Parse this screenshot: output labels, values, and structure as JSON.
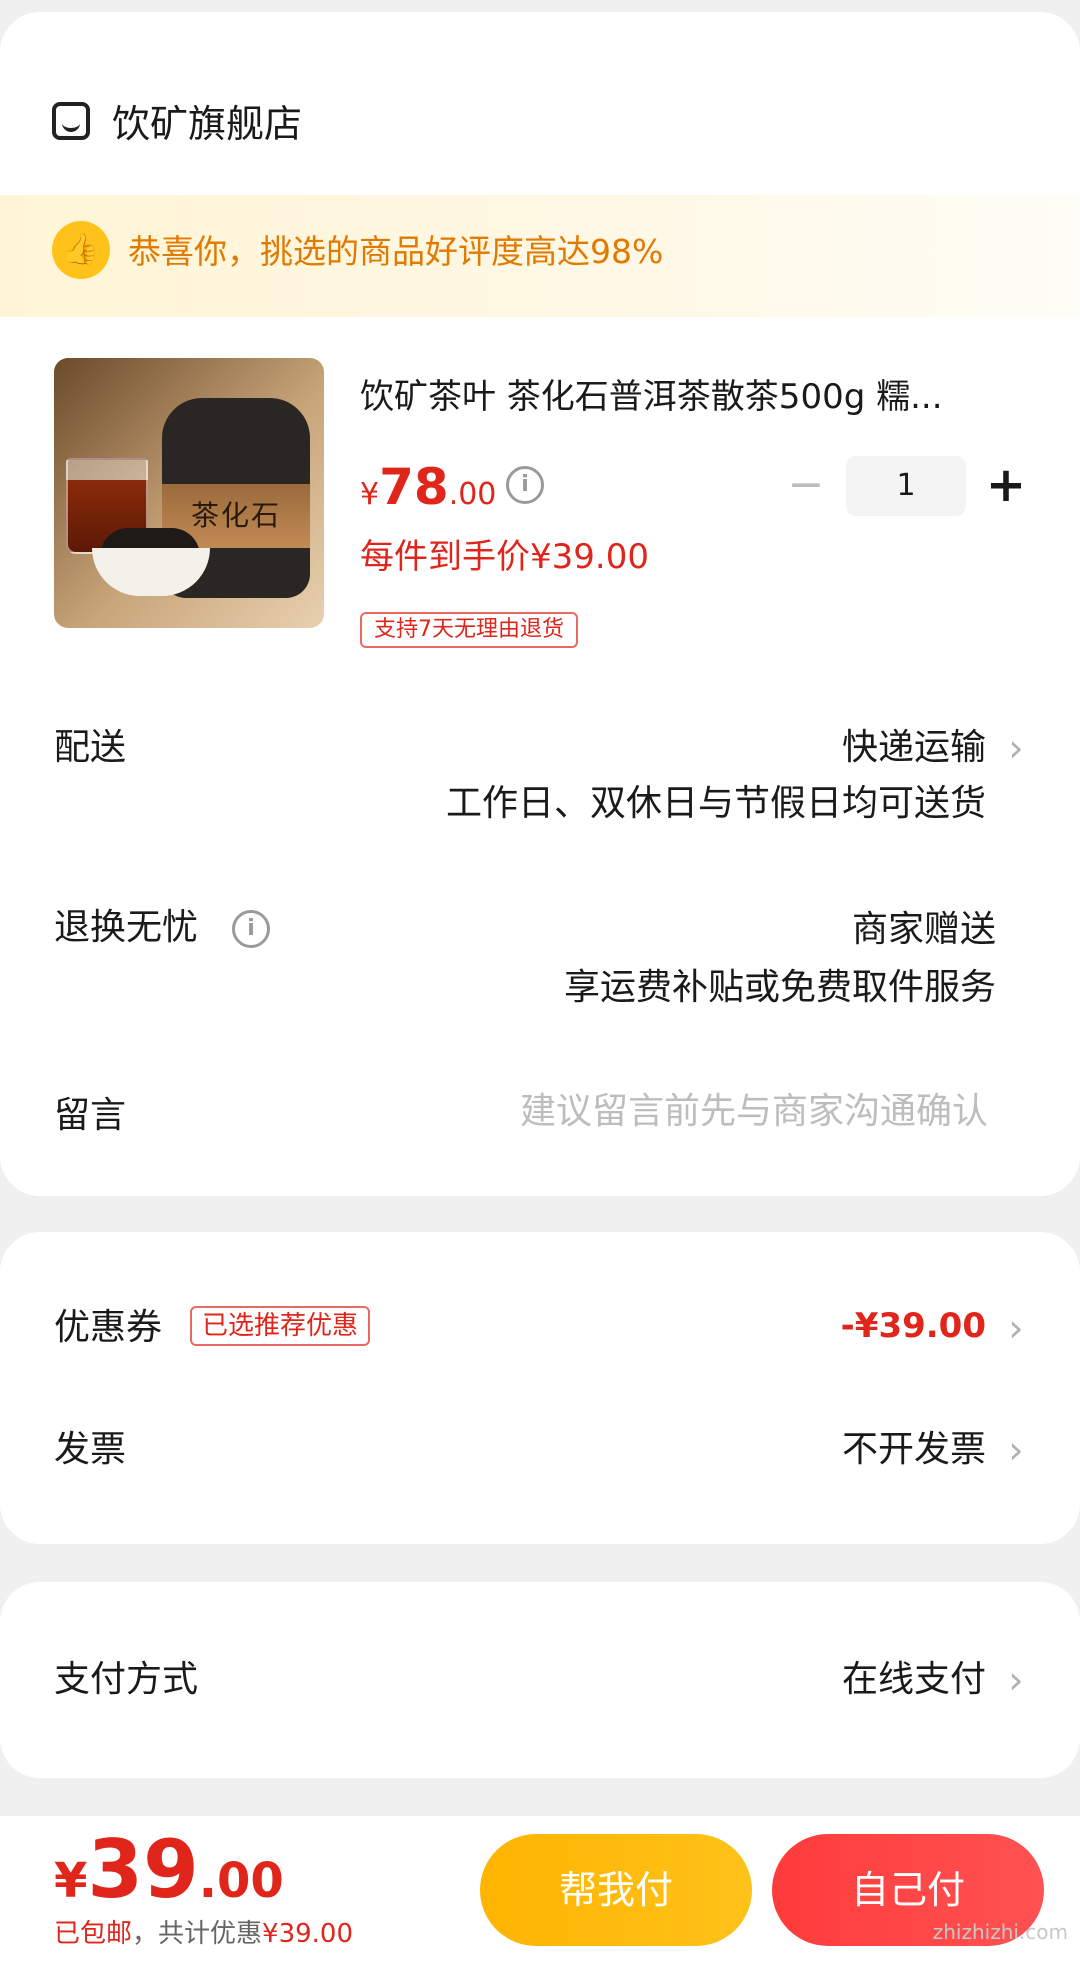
{
  "store": {
    "name": "饮矿旗舰店",
    "icon": "store-icon"
  },
  "banner": {
    "text": "恭喜你，挑选的商品好评度高达98%",
    "icon": "thumbs-up-icon",
    "color": "#e07a00"
  },
  "product": {
    "title": "饮矿茶叶  茶化石普洱茶散茶500g 糯...",
    "image_label": "茶化石",
    "price": {
      "symbol": "¥",
      "integer": "78",
      "decimal": ".00"
    },
    "final_price": "每件到手价¥39.00",
    "return_tag": "支持7天无理由退货",
    "quantity": "1",
    "minus_glyph": "−",
    "plus_glyph": "+"
  },
  "delivery": {
    "label": "配送",
    "value": "快递运输",
    "sub": "工作日、双休日与节假日均可送货"
  },
  "return_service": {
    "label": "退换无忧",
    "value": "商家赠送",
    "sub": "享运费补贴或免费取件服务"
  },
  "message": {
    "label": "留言",
    "placeholder": "建议留言前先与商家沟通确认"
  },
  "coupon": {
    "label": "优惠券",
    "badge": "已选推荐优惠",
    "value": "-¥39.00"
  },
  "invoice": {
    "label": "发票",
    "value": "不开发票"
  },
  "payment": {
    "label": "支付方式",
    "value": "在线支付"
  },
  "bottom": {
    "total": {
      "symbol": "¥",
      "integer": "39",
      "decimal": ".00"
    },
    "shipping": "已包邮",
    "discount_prefix": "，共计优惠",
    "discount_value": "¥39.00",
    "help_pay": "帮我付",
    "self_pay": "自己付"
  },
  "info_glyph": "i",
  "chevron_glyph": "›",
  "watermark": "zhizhizhi.com",
  "colors": {
    "accent_red": "#e0251b",
    "orange": "#e07a00",
    "yellow_btn": "#ffb400",
    "red_btn": "#ff3b3b"
  }
}
